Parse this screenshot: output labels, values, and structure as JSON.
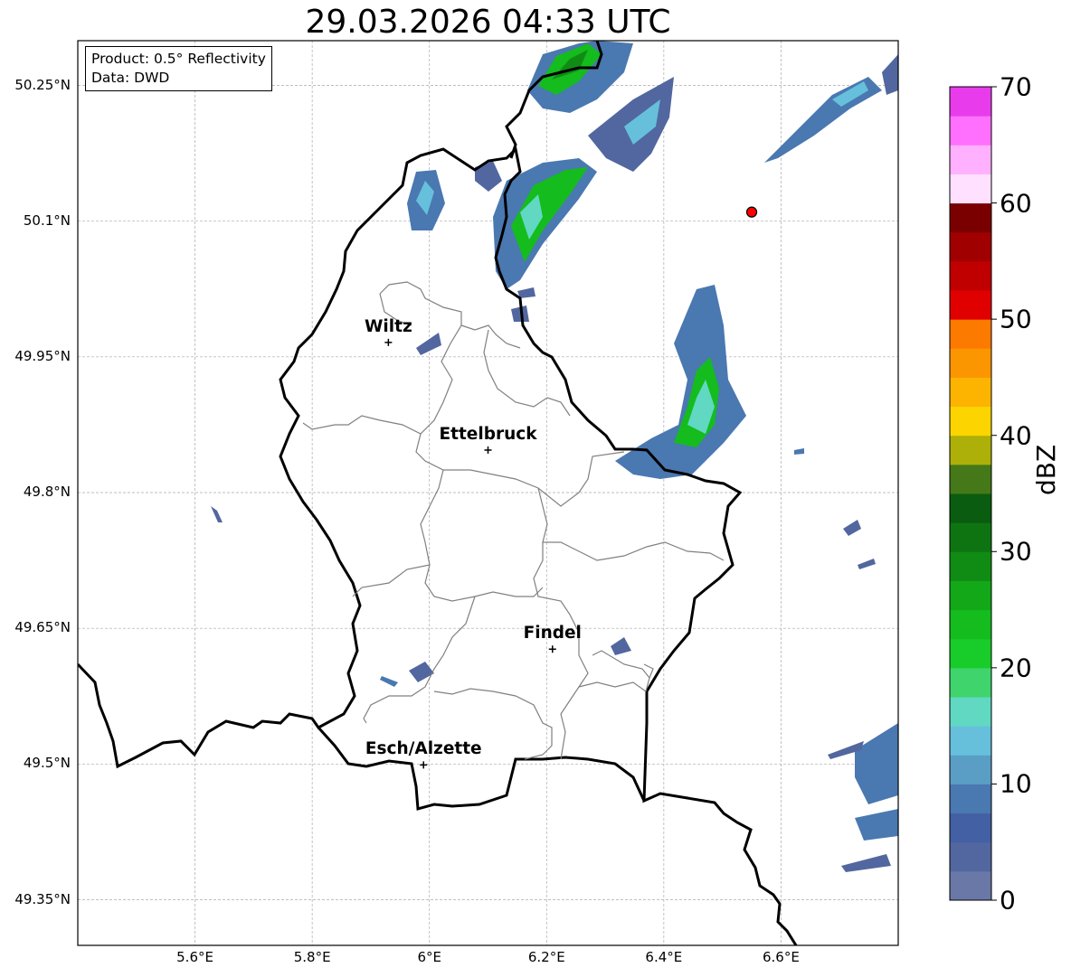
{
  "title": "29.03.2026 04:33 UTC",
  "infobox": {
    "product": "Product: 0.5° Reflectivity",
    "data": "Data: DWD"
  },
  "axes": {
    "lat_ticks": [
      "50.25°N",
      "50.1°N",
      "49.95°N",
      "49.8°N",
      "49.65°N",
      "49.5°N",
      "49.35°N"
    ],
    "lon_ticks": [
      "5.6°E",
      "5.8°E",
      "6°E",
      "6.2°E",
      "6.4°E",
      "6.6°E"
    ],
    "lat_range": [
      49.3,
      50.3
    ],
    "lon_range": [
      5.4,
      6.8
    ],
    "grid": true
  },
  "cities": [
    {
      "name": "Wiltz",
      "lon": 5.93,
      "lat": 49.966
    },
    {
      "name": "Ettelbruck",
      "lon": 6.1,
      "lat": 49.847
    },
    {
      "name": "Findel",
      "lon": 6.21,
      "lat": 49.627
    },
    {
      "name": "Esch/Alzette",
      "lon": 5.99,
      "lat": 49.499
    }
  ],
  "marker": {
    "lon": 6.55,
    "lat": 50.11,
    "color": "#ff0000"
  },
  "colorbar": {
    "label": "dBZ",
    "ticks": [
      "0",
      "10",
      "20",
      "30",
      "40",
      "50",
      "60",
      "70"
    ],
    "min": 0,
    "max": 70,
    "colors": [
      "#6a78a8",
      "#52679f",
      "#4360a4",
      "#4a78b0",
      "#5a9ec6",
      "#66c0dc",
      "#60d8c2",
      "#40d46c",
      "#18cc2a",
      "#14bc1e",
      "#12a818",
      "#108c14",
      "#0e7412",
      "#0a5c10",
      "#447818",
      "#acb008",
      "#fcd400",
      "#fcb400",
      "#fc9600",
      "#fc7a00",
      "#e00000",
      "#c00000",
      "#a00000",
      "#7a0000",
      "#ffe0ff",
      "#ffb0ff",
      "#ff70ff",
      "#e83cec"
    ]
  }
}
